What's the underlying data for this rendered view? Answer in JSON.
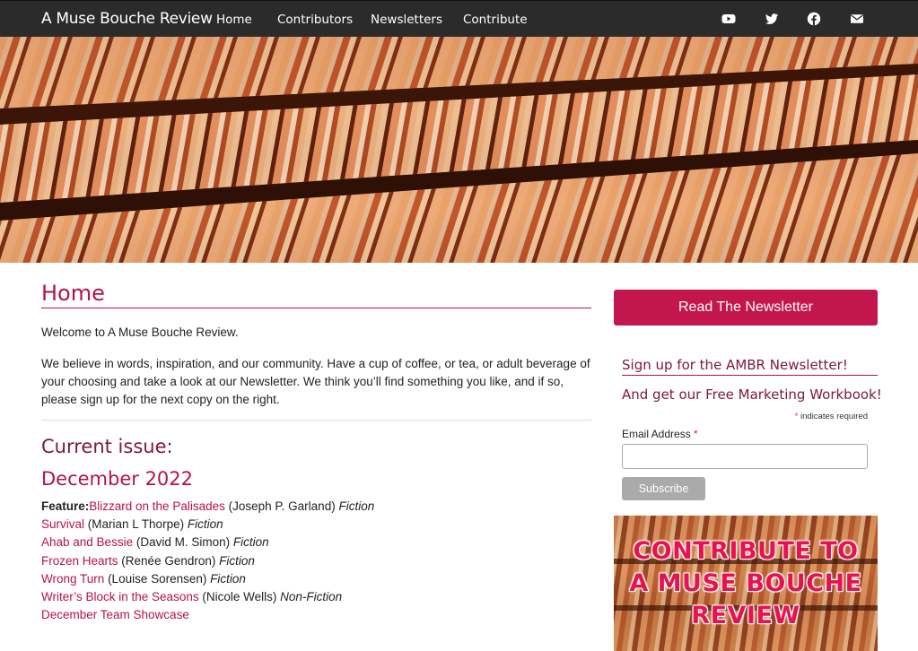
{
  "nav": {
    "brand": "A Muse Bouche Review",
    "links": [
      "Home",
      "Contributors",
      "Newsletters",
      "Contribute"
    ],
    "social": [
      "youtube-icon",
      "twitter-icon",
      "facebook-icon",
      "email-icon"
    ]
  },
  "main": {
    "title": "Home",
    "welcome": "Welcome to A Muse Bouche Review.",
    "intro": "We believe in words, inspiration, and our community. Have a cup of coffee, or tea, or adult beverage of your choosing and take a look at our Newsletter. We think you’ll find something you like, and if so, please sign up for the next copy on the right.",
    "current_heading": "Current issue:",
    "month": "December 2022",
    "feature_label": "Feature:",
    "items": [
      {
        "title": "Blizzard on the Palisades",
        "author": "(Joseph P. Garland)",
        "genre": "Fiction"
      },
      {
        "title": "Survival",
        "author": "(Marian L Thorpe)",
        "genre": "Fiction"
      },
      {
        "title": "Ahab and Bessie",
        "author": "(David M. Simon)",
        "genre": "Fiction"
      },
      {
        "title": "Frozen Hearts",
        "author": "(Renée Gendron)",
        "genre": "Fiction"
      },
      {
        "title": "Wrong Turn",
        "author": "(Louise Sorensen)",
        "genre": "Fiction"
      },
      {
        "title": "Writer’s Block in the Seasons",
        "author": "(Nicole Wells)",
        "genre": "Non-Fiction"
      },
      {
        "title": "December Team Showcase",
        "author": "",
        "genre": ""
      }
    ]
  },
  "sidebar": {
    "read_button": "Read The Newsletter",
    "signup_title": "Sign up for the AMBR Newsletter!",
    "workbook": "And get our Free Marketing Workbook!",
    "required_star": "*",
    "required_note": "indicates required",
    "email_label": "Email Address",
    "email_value": "",
    "subscribe_button": "Subscribe",
    "promo_line1": "CONTRIBUTE TO",
    "promo_line2": "A MUSE BOUCHE",
    "promo_line3": "REVIEW"
  },
  "colors": {
    "accent": "#c4164e",
    "heading": "#7c1740",
    "nav_bg": "#2b2b2b"
  }
}
